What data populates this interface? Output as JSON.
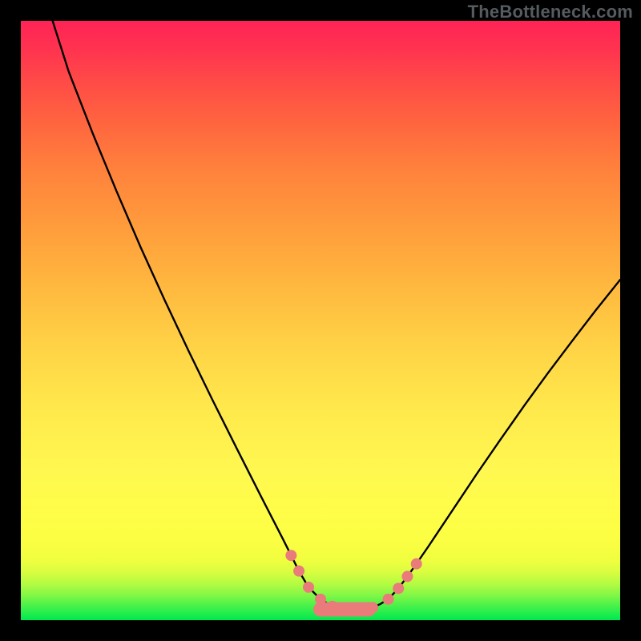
{
  "watermark": "TheBottleneck.com",
  "chart_data": {
    "type": "line",
    "title": "",
    "xlabel": "",
    "ylabel": "",
    "xlim": [
      0,
      100
    ],
    "ylim": [
      0,
      100
    ],
    "series": [
      {
        "name": "curve",
        "x": [
          5.3,
          8.0,
          12.0,
          16.0,
          20.0,
          24.0,
          28.0,
          32.0,
          36.0,
          40.0,
          42.0,
          43.7,
          45.1,
          46.4,
          48.0,
          50.0,
          52.0,
          53.0,
          54.0,
          55.0,
          56.0,
          57.3,
          58.7,
          60.0,
          61.3,
          63.0,
          64.5,
          66.0,
          68.0,
          70.0,
          73.0,
          76.0,
          80.0,
          84.0,
          88.0,
          92.0,
          96.0,
          100.0
        ],
        "values": [
          100.0,
          91.5,
          81.2,
          71.5,
          62.2,
          53.4,
          44.9,
          36.7,
          28.7,
          20.8,
          16.9,
          13.6,
          10.8,
          8.2,
          5.5,
          3.5,
          2.3,
          1.9,
          1.7,
          1.7,
          1.7,
          1.8,
          2.1,
          2.7,
          3.5,
          5.3,
          7.3,
          9.4,
          12.3,
          15.3,
          19.8,
          24.3,
          30.1,
          35.8,
          41.3,
          46.6,
          51.8,
          56.8
        ]
      }
    ],
    "markers": [
      {
        "x": 45.1,
        "y": 10.8,
        "color": "#e97b7b"
      },
      {
        "x": 46.4,
        "y": 8.2,
        "color": "#e97b7b"
      },
      {
        "x": 48.0,
        "y": 5.5,
        "color": "#e97b7b"
      },
      {
        "x": 50.0,
        "y": 3.5,
        "color": "#e97b7b"
      },
      {
        "x": 52.0,
        "y": 2.3,
        "color": "#e97b7b"
      },
      {
        "x": 54.0,
        "y": 1.7,
        "color": "#e97b7b"
      },
      {
        "x": 56.0,
        "y": 1.7,
        "color": "#e97b7b"
      },
      {
        "x": 58.7,
        "y": 2.1,
        "color": "#e97b7b"
      },
      {
        "x": 61.3,
        "y": 3.5,
        "color": "#e97b7b"
      },
      {
        "x": 63.0,
        "y": 5.3,
        "color": "#e97b7b"
      },
      {
        "x": 64.5,
        "y": 7.3,
        "color": "#e97b7b"
      },
      {
        "x": 66.0,
        "y": 9.4,
        "color": "#e97b7b"
      }
    ],
    "bottom_strip_rect": {
      "x": 48.8,
      "y": 0.6,
      "w": 10.4,
      "h": 2.4,
      "rx": 1.2,
      "color": "#e97b7b"
    },
    "gradient_stops": [
      {
        "pct": 0,
        "color": "#00e84f"
      },
      {
        "pct": 10,
        "color": "#f0fe40"
      },
      {
        "pct": 25,
        "color": "#fff850"
      },
      {
        "pct": 55,
        "color": "#ffba3f"
      },
      {
        "pct": 83,
        "color": "#ff653f"
      },
      {
        "pct": 100,
        "color": "#ff2356"
      }
    ]
  }
}
